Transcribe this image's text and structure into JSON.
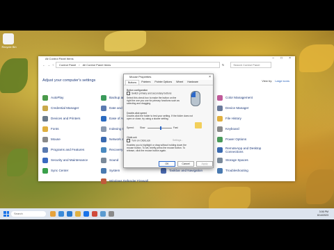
{
  "desktop": {
    "recycle_label": "Recycle Bin"
  },
  "control_panel": {
    "window_title": "All Control Panel Items",
    "breadcrumb": [
      "Control Panel",
      "All Control Panel Items"
    ],
    "search_placeholder": "Search Control Panel",
    "heading": "Adjust your computer's settings",
    "view_by_label": "View by:",
    "view_by_value": "Large icons",
    "col1": [
      "AutoPlay",
      "Credential Manager",
      "Devices and Printers",
      "Fonts",
      "Mouse",
      "Programs and Features",
      "Security and Maintenance",
      "Sync Center"
    ],
    "col2": [
      "Backup and Restore (Windows 7)",
      "Date and Time",
      "Ease of Access Center",
      "Indexing Options",
      "Network and Sharing Center",
      "Recovery",
      "Sound",
      "System",
      "Windows Defender Firewall"
    ],
    "col3": [
      "Color Management",
      "Device Manager",
      "File History",
      "Keyboard",
      "Power Options",
      "RemoteApp and Desktop Connections",
      "Storage Spaces",
      "Troubleshooting"
    ],
    "col3_extra": "Taskbar and Navigation"
  },
  "dialog": {
    "title": "Mouse Properties",
    "tabs": [
      "Buttons",
      "Pointers",
      "Pointer Options",
      "Wheel",
      "Hardware"
    ],
    "button_config_heading": "Button configuration",
    "switch_label": "Switch primary and secondary buttons",
    "switch_desc": "Select this check box to make the button on the right the one you use for primary functions such as selecting and dragging.",
    "dblclick_heading": "Double-click speed",
    "dblclick_desc": "Double-click the folder to test your setting. If the folder does not open or close, try using a slower setting.",
    "speed_label": "Speed:",
    "slow_label": "Slow",
    "fast_label": "Fast",
    "speed_fraction": 0.5,
    "clicklock_heading": "ClickLock",
    "clicklock_label": "Turn on ClickLock",
    "settings_label": "Settings...",
    "clicklock_desc": "Enables you to highlight or drag without holding down the mouse button. To set, briefly press the mouse button. To release, click the mouse button again.",
    "ok_label": "OK",
    "cancel_label": "Cancel",
    "apply_label": "Apply"
  },
  "taskbar": {
    "search_placeholder": "Search",
    "time": "3:06 PM",
    "date": "6/14/2023"
  }
}
